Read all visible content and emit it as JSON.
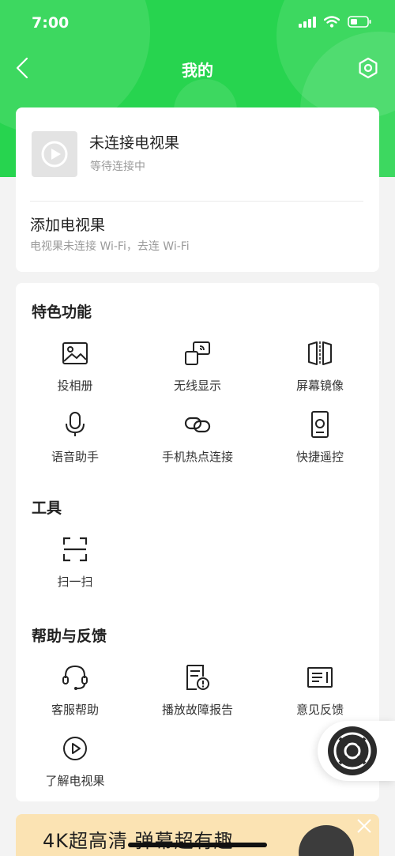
{
  "status_bar": {
    "time": "7:00"
  },
  "nav": {
    "title": "我的"
  },
  "device": {
    "name": "未连接电视果",
    "status": "等待连接中",
    "add_title": "添加电视果",
    "add_subtitle": "电视果未连接 Wi-Fi，去连 Wi-Fi"
  },
  "features": {
    "title": "特色功能",
    "items": [
      {
        "label": "投相册",
        "icon": "photo-album-icon"
      },
      {
        "label": "无线显示",
        "icon": "wireless-display-icon"
      },
      {
        "label": "屏幕镜像",
        "icon": "screen-mirror-icon"
      },
      {
        "label": "语音助手",
        "icon": "microphone-icon"
      },
      {
        "label": "手机热点连接",
        "icon": "link-icon"
      },
      {
        "label": "快捷遥控",
        "icon": "remote-control-icon"
      }
    ]
  },
  "tools": {
    "title": "工具",
    "items": [
      {
        "label": "扫一扫",
        "icon": "scan-icon"
      }
    ]
  },
  "help": {
    "title": "帮助与反馈",
    "items": [
      {
        "label": "客服帮助",
        "icon": "headset-icon"
      },
      {
        "label": "播放故障报告",
        "icon": "report-icon"
      },
      {
        "label": "意见反馈",
        "icon": "feedback-icon"
      },
      {
        "label": "了解电视果",
        "icon": "play-circle-icon"
      }
    ]
  },
  "banner": {
    "text": "4K超高清 弹幕超有趣"
  },
  "colors": {
    "brand": "#27d44f",
    "background": "#f3f3f3",
    "banner": "#fbe3b3"
  }
}
